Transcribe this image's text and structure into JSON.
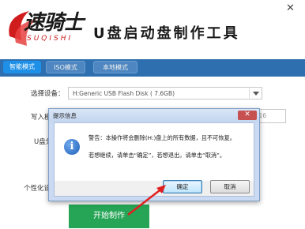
{
  "header": {
    "logo_text": "速骑士",
    "logo_sub": "SUQISHI",
    "title": "U盘启动盘制作工具",
    "close_glyph": "✕"
  },
  "tabs": [
    {
      "label": "智能模式",
      "active": true
    },
    {
      "label": "ISO模式",
      "active": false
    },
    {
      "label": "本地模式",
      "active": false
    }
  ],
  "form": {
    "device_label": "选择设备：",
    "device_value": "H:Generic USB Flash Disk ( 7.6GB)",
    "write_label": "写入模",
    "u_label": "U盘分",
    "personal_label": "个性化设",
    "fs_value": "T16"
  },
  "start_button": "开始制作",
  "dialog": {
    "title": "提示信息",
    "icon": "info-icon",
    "message_line1": "警告：本操作将会删除(H:)盘上的所有数据，且不可恢复。",
    "message_line2": "若想继续，请单击“确定”，若想退出，请单击“取消”。",
    "ok_label": "确定",
    "cancel_label": "取消",
    "close_glyph": "✕"
  },
  "colors": {
    "tab_bar": "#2e6fb0",
    "start_button": "#26a556",
    "dialog_frame": "#c9daf2",
    "annotation_arrow": "#e02020"
  }
}
